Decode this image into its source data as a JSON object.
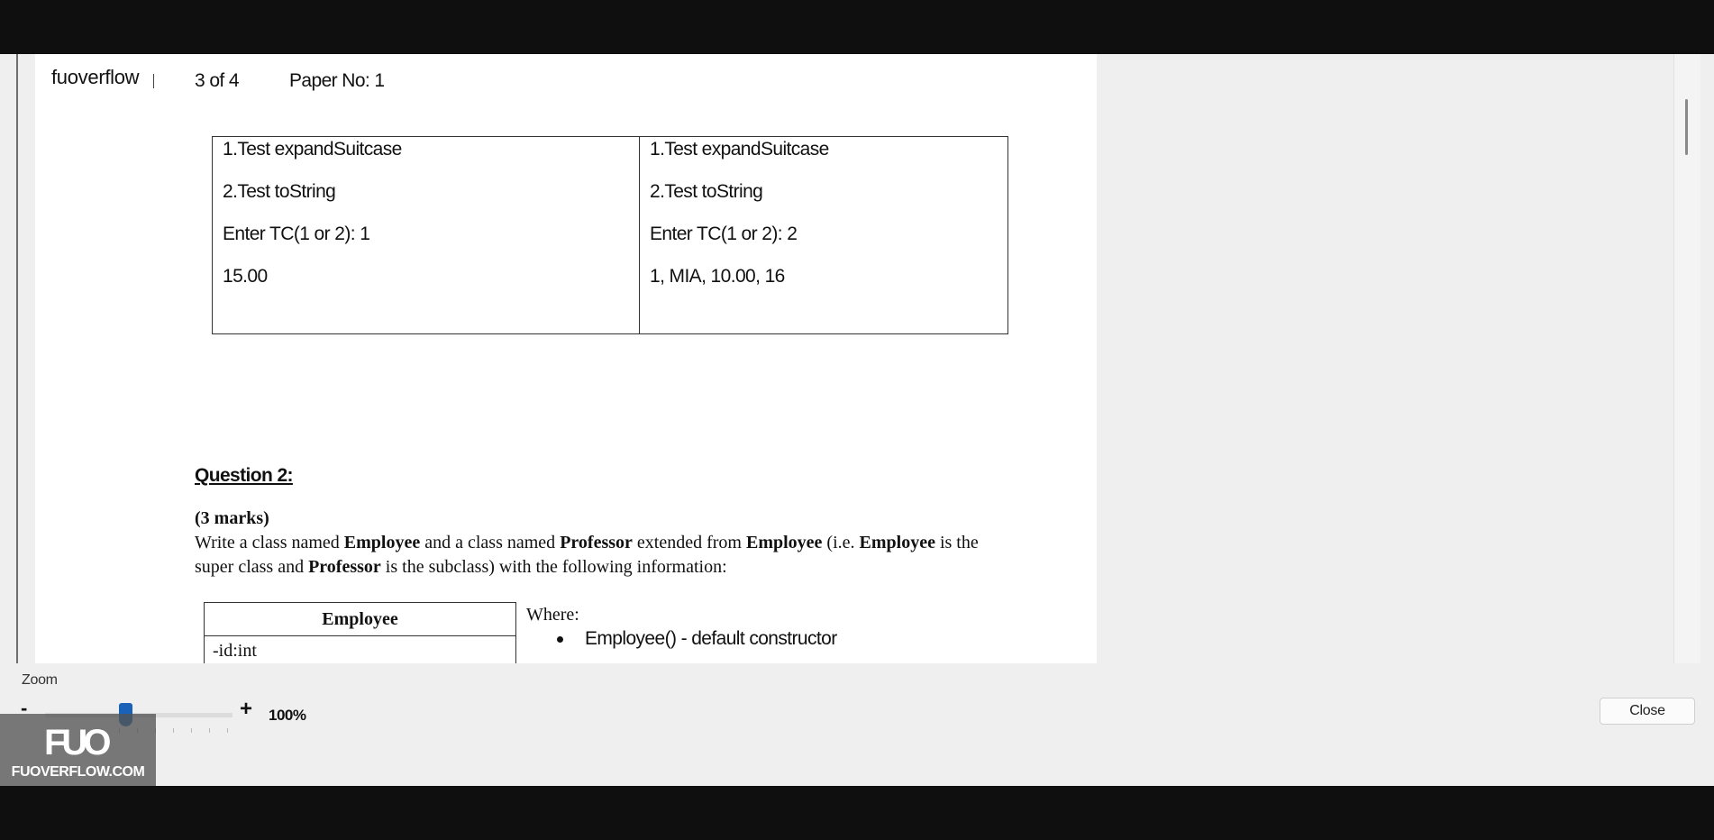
{
  "header": {
    "brand": "fuoverflow",
    "page_count": "3 of 4",
    "paper_no": "Paper No: 1"
  },
  "io_table": {
    "left": [
      "1.Test expandSuitcase",
      "2.Test toString",
      "Enter TC(1 or 2): 1",
      "15.00"
    ],
    "right": [
      "1.Test expandSuitcase",
      "2.Test toString",
      "Enter TC(1 or 2): 2",
      "1, MIA, 10.00, 16"
    ]
  },
  "question": {
    "title": "Question 2:",
    "marks": "(3 marks)",
    "desc_1": "Write a class named ",
    "employee": "Employee",
    "desc_2": " and a class named ",
    "professor": "Professor",
    "desc_3": " extended from ",
    "desc_4": " (i.e. ",
    "desc_5": " is the super class and ",
    "desc_6": " is the subclass) with the following information:"
  },
  "uml": {
    "class_name": "Employee",
    "attributes": [
      "-id:int"
    ]
  },
  "where": {
    "label": "Where:",
    "bullets": [
      "Employee() - default constructor"
    ]
  },
  "zoom": {
    "label": "Zoom",
    "minus": "-",
    "plus": "+",
    "value_text": "100%",
    "level": 0.43
  },
  "close_label": "Close",
  "watermark": {
    "logo": "FUO",
    "site": "FUOVERFLOW.COM"
  },
  "icons": [
    "bullet-icon",
    "slider-thumb-icon"
  ]
}
